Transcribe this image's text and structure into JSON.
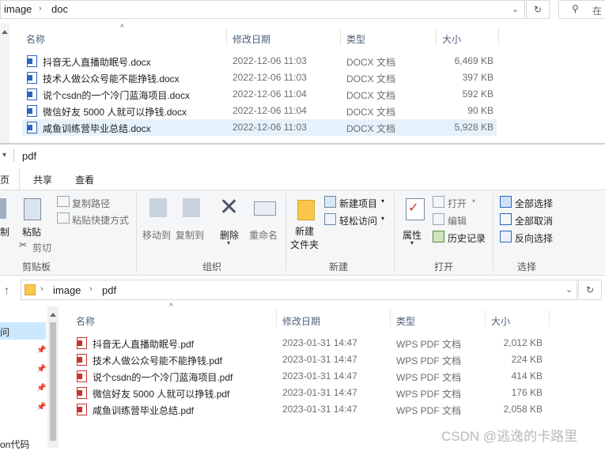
{
  "top_window": {
    "breadcrumb": [
      "image",
      "doc"
    ],
    "search_placeholder": "在",
    "columns": {
      "name": "名称",
      "modified": "修改日期",
      "type": "类型",
      "size": "大小"
    },
    "rows": [
      {
        "name": "抖音无人直播助眠号.docx",
        "modified": "2022-12-06 11:03",
        "type": "DOCX 文档",
        "size": "6,469 KB"
      },
      {
        "name": "技术人做公众号能不能挣钱.docx",
        "modified": "2022-12-06 11:03",
        "type": "DOCX 文档",
        "size": "397 KB"
      },
      {
        "name": "说个csdn的一个冷门蓝海项目.docx",
        "modified": "2022-12-06 11:04",
        "type": "DOCX 文档",
        "size": "592 KB"
      },
      {
        "name": "微信好友 5000 人就可以挣钱.docx",
        "modified": "2022-12-06 11:04",
        "type": "DOCX 文档",
        "size": "90 KB"
      },
      {
        "name": "咸鱼训练营毕业总结.docx",
        "modified": "2022-12-06 11:03",
        "type": "DOCX 文档",
        "size": "5,928 KB"
      }
    ]
  },
  "bottom_window": {
    "title": "pdf",
    "tabs": [
      "页",
      "共享",
      "查看"
    ],
    "ribbon": {
      "clipboard": {
        "cut_partial": "制",
        "paste": "粘贴",
        "copy_path": "复制路径",
        "paste_shortcut": "粘贴快捷方式",
        "cut": "剪切",
        "title": "剪贴板"
      },
      "organize": {
        "move_to": "移动到",
        "copy_to": "复制到",
        "delete": "删除",
        "rename": "重命名",
        "title": "组织"
      },
      "new": {
        "new_folder": "新建\n文件夹",
        "new_item": "新建项目",
        "easy_access": "轻松访问",
        "title": "新建"
      },
      "open": {
        "properties": "属性",
        "open": "打开",
        "edit": "编辑",
        "history": "历史记录",
        "title": "打开"
      },
      "select": {
        "select_all": "全部选择",
        "select_none": "全部取消",
        "invert": "反向选择",
        "title": "选择"
      }
    },
    "breadcrumb": [
      "image",
      "pdf"
    ],
    "nav_partial": "问",
    "nav_bottom": "on代码",
    "columns": {
      "name": "名称",
      "modified": "修改日期",
      "type": "类型",
      "size": "大小"
    },
    "rows": [
      {
        "name": "抖音无人直播助眠号.pdf",
        "modified": "2023-01-31 14:47",
        "type": "WPS PDF 文档",
        "size": "2,012 KB"
      },
      {
        "name": "技术人做公众号能不能挣钱.pdf",
        "modified": "2023-01-31 14:47",
        "type": "WPS PDF 文档",
        "size": "224 KB"
      },
      {
        "name": "说个csdn的一个冷门蓝海项目.pdf",
        "modified": "2023-01-31 14:47",
        "type": "WPS PDF 文档",
        "size": "414 KB"
      },
      {
        "name": "微信好友 5000 人就可以挣钱.pdf",
        "modified": "2023-01-31 14:47",
        "type": "WPS PDF 文档",
        "size": "176 KB"
      },
      {
        "name": "咸鱼训练营毕业总结.pdf",
        "modified": "2023-01-31 14:47",
        "type": "WPS PDF 文档",
        "size": "2,058 KB"
      }
    ]
  },
  "watermark": "CSDN @逃逸的卡路里"
}
